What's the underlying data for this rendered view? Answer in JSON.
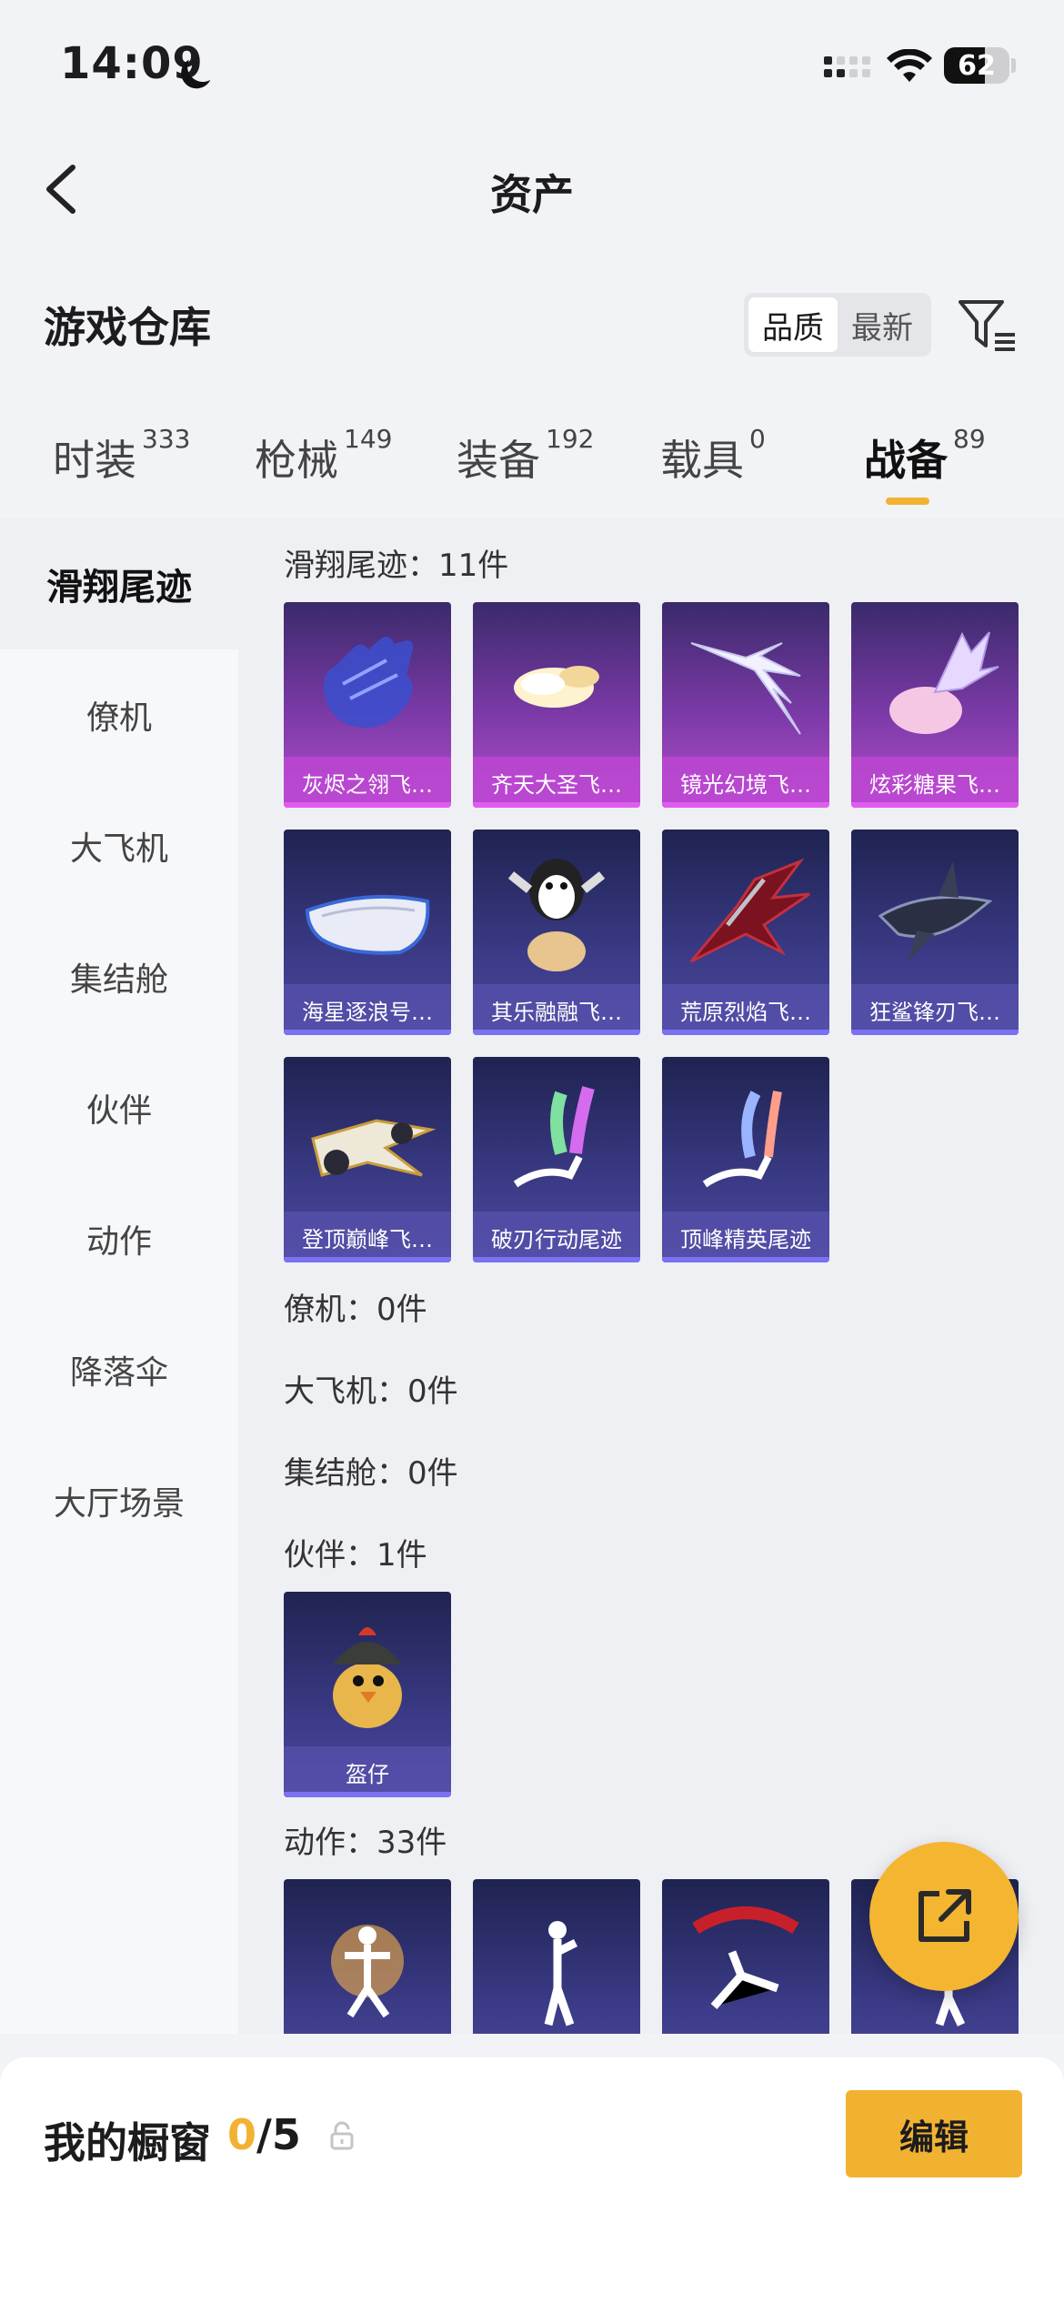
{
  "status_bar": {
    "time": "14:09",
    "battery": "62",
    "battery_level": 0.62
  },
  "nav": {
    "title": "资产"
  },
  "warehouse": {
    "title": "游戏仓库",
    "sort_options": [
      "品质",
      "最新"
    ],
    "active_sort": "品质"
  },
  "tabs": [
    {
      "label": "时装",
      "count": "333"
    },
    {
      "label": "枪械",
      "count": "149"
    },
    {
      "label": "装备",
      "count": "192"
    },
    {
      "label": "载具",
      "count": "0"
    },
    {
      "label": "战备",
      "count": "89",
      "active": true
    }
  ],
  "sidebar": [
    {
      "label": "滑翔尾迹",
      "active": true
    },
    {
      "label": "僚机"
    },
    {
      "label": "大飞机"
    },
    {
      "label": "集结舱"
    },
    {
      "label": "伙伴"
    },
    {
      "label": "动作"
    },
    {
      "label": "降落伞"
    },
    {
      "label": "大厅场景"
    }
  ],
  "sections": {
    "trails": {
      "header": "滑翔尾迹：11件",
      "items": [
        {
          "name": "灰烬之翎飞…",
          "rarity": "purple",
          "icon": "glove-icon"
        },
        {
          "name": "齐天大圣飞…",
          "rarity": "purple",
          "icon": "cloud-icon"
        },
        {
          "name": "镜光幻境飞…",
          "rarity": "purple",
          "icon": "wings-icon"
        },
        {
          "name": "炫彩糖果飞…",
          "rarity": "purple",
          "icon": "candy-icon"
        },
        {
          "name": "海星逐浪号…",
          "rarity": "blue",
          "icon": "boat-icon"
        },
        {
          "name": "其乐融融飞…",
          "rarity": "blue",
          "icon": "penguin-icon"
        },
        {
          "name": "荒原烈焰飞…",
          "rarity": "blue",
          "icon": "dragon-icon"
        },
        {
          "name": "狂鲨锋刃飞…",
          "rarity": "blue",
          "icon": "shark-icon"
        },
        {
          "name": "登顶巅峰飞…",
          "rarity": "blue",
          "icon": "jet-icon"
        },
        {
          "name": "破刃行动尾迹",
          "rarity": "blue",
          "icon": "rainbow-trail-icon"
        },
        {
          "name": "顶峰精英尾迹",
          "rarity": "blue",
          "icon": "smoke-trail-icon"
        }
      ]
    },
    "wingman": {
      "header": "僚机：0件"
    },
    "aircraft": {
      "header": "大飞机：0件"
    },
    "pod": {
      "header": "集结舱：0件"
    },
    "partner": {
      "header": "伙伴：1件",
      "items": [
        {
          "name": "盔仔",
          "rarity": "blue",
          "icon": "chick-helmet-icon"
        }
      ]
    },
    "emote": {
      "header": "动作：33件"
    }
  },
  "showcase": {
    "title": "我的橱窗",
    "current": "0",
    "total": "/5",
    "edit_label": "编辑"
  }
}
